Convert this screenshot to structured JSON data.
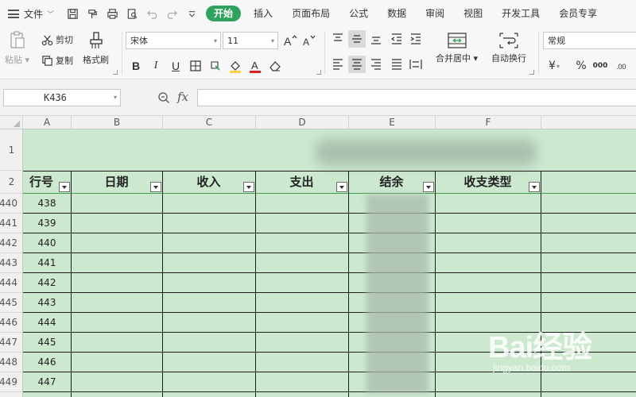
{
  "menubar": {
    "file_label": "文件",
    "tabs": [
      "开始",
      "插入",
      "页面布局",
      "公式",
      "数据",
      "审阅",
      "视图",
      "开发工具",
      "会员专享"
    ],
    "active_tab_color": "#2ea35d"
  },
  "quick_access": {
    "icons": [
      "save-icon",
      "format-painter-icon",
      "print-icon",
      "print-preview-icon",
      "undo-icon",
      "redo-icon",
      "customize-icon"
    ]
  },
  "ribbon": {
    "paste_label": "粘贴",
    "cut_label": "剪切",
    "copy_label": "复制",
    "format_painter_label": "格式刷",
    "font_name": "宋体",
    "font_size": "11",
    "bold": "B",
    "italic": "I",
    "underline": "U",
    "merge_label": "合并居中",
    "wrap_label": "自动换行",
    "number_format": "常规",
    "currency_symbol": "¥",
    "percent_symbol": "%",
    "thousands_symbol": "000",
    "font_color": "#e02020",
    "fill_color": "#f5d040"
  },
  "formula_bar": {
    "name_box": "K436",
    "fx_label": "fx",
    "formula_value": ""
  },
  "grid": {
    "columns": [
      "A",
      "B",
      "C",
      "D",
      "E",
      "F"
    ],
    "row_headers": [
      "1",
      "2",
      "440",
      "441",
      "442",
      "443",
      "444",
      "445",
      "446",
      "447",
      "448",
      "449"
    ],
    "header_row": [
      "行号",
      "日期",
      "收入",
      "支出",
      "结余",
      "收支类型"
    ],
    "data_rows": [
      "438",
      "439",
      "440",
      "441",
      "442",
      "443",
      "444",
      "445",
      "446",
      "447"
    ],
    "sheet_bg": "#cce8cf"
  },
  "watermark": {
    "brand": "Bai经验",
    "url": "jingyan.baidu.com"
  }
}
